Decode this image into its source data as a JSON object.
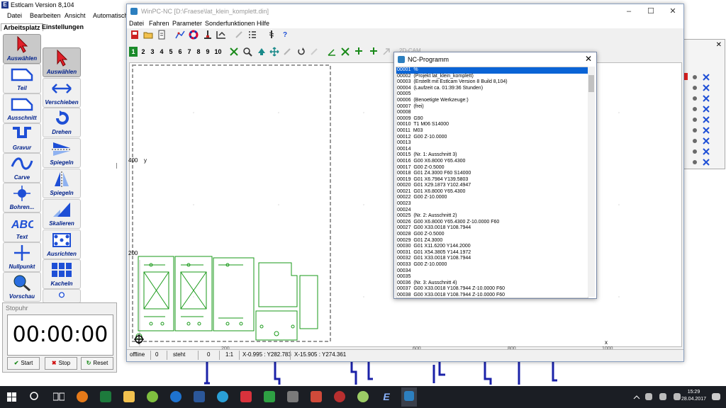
{
  "estlcam": {
    "title": "Estlcam Version 8,104",
    "menu": [
      "Datei",
      "Bearbeiten",
      "Ansicht",
      "Automatisch"
    ],
    "tabs": [
      "Arbeitsplatz",
      "Einstellungen"
    ],
    "tools_left": [
      "Auswählen",
      "Teil",
      "Ausschnitt",
      "Gravur",
      "Carve",
      "Bohren...",
      "Text",
      "Nullpunkt",
      "Vorschau"
    ],
    "tools_right": [
      "Auswählen",
      "Verschieben",
      "Drehen",
      "Spiegeln",
      "Spiegeln",
      "Skalieren",
      "Ausrichten",
      "Kacheln"
    ],
    "stopwatch": {
      "title": "Stopuhr",
      "time": "00:00:00",
      "start": "Start",
      "stop": "Stop",
      "reset": "Reset"
    }
  },
  "winpc": {
    "title": "WinPC-NC [D:\\Fraese\\lat_klein_komplett.din]",
    "menu": [
      "Datei",
      "Fahren",
      "Parameter",
      "Sonderfunktionen",
      "Hilfe"
    ],
    "tool_numbers": [
      "1",
      "2",
      "3",
      "4",
      "5",
      "6",
      "7",
      "8",
      "9",
      "10"
    ],
    "canvas": {
      "y_ticks": [
        "400",
        "200"
      ],
      "y_axis_label": "y",
      "x_ticks": [
        "200",
        "600",
        "800",
        "1000"
      ],
      "x_axis_label": "x",
      "tab_label": "2D-CAM"
    },
    "status": {
      "mode": "offline",
      "count": "0",
      "state": "steht",
      "val": "0",
      "scale": "1:1",
      "coord1": "X-0.995 : Y282.783",
      "coord2": "X-15.905 : Y274.361"
    }
  },
  "nc_program": {
    "title": "NC-Programm",
    "lines": [
      "00001  %",
      "00002  (Projekt lat_klein_komplett)",
      "00003  (Erstellt mit Estlcam Version 8 Build 8,104)",
      "00004  (Laufzeit ca. 01:39:36 Stunden)",
      "00005",
      "00006  (Benoetigte Werkzeuge:)",
      "00007  (frei)",
      "00008",
      "00009  G90",
      "00010  T1 M06 S14000",
      "00011  M03",
      "00012  G00 Z-10.0000",
      "00013",
      "00014",
      "00015  (Nr. 1: Ausschnitt 3)",
      "00016  G00 X6.8000 Y65.4300",
      "00017  G00 Z-0.5000",
      "00018  G01 Z4.3000 F60 S14000",
      "00019  G01 X6.7984 Y139.5803",
      "00020  G01 X29.1873 Y102.4947",
      "00021  G01 X6.8000 Y65.4300",
      "00022  G00 Z-10.0000",
      "00023",
      "00024",
      "00025  (Nr. 2: Ausschnitt 2)",
      "00026  G00 X6.8000 Y65.4300 Z-10.0000 F60",
      "00027  G00 X33.0018 Y108.7944",
      "00028  G00 Z-0.5000",
      "00029  G01 Z4.3000",
      "00030  G01 X11.6200 Y144.2000",
      "00031  G01 X54.3805 Y144.1972",
      "00032  G01 X33.0018 Y108.7944",
      "00033  G00 Z-10.0000",
      "00034",
      "00035",
      "00036  (Nr. 3: Ausschnitt 4)",
      "00037  G00 X33.0018 Y108.7944 Z-10.0000 F60",
      "00038  G00 X33.0018 Y108.7944 Z-10.0000 F60"
    ]
  },
  "taskbar": {
    "time": "15:29",
    "date": "28.04.2017"
  },
  "colors": {
    "accent_blue": "#1e4fd6",
    "green_paths": "#1a9a1a",
    "highlight": "#0a64d6"
  }
}
